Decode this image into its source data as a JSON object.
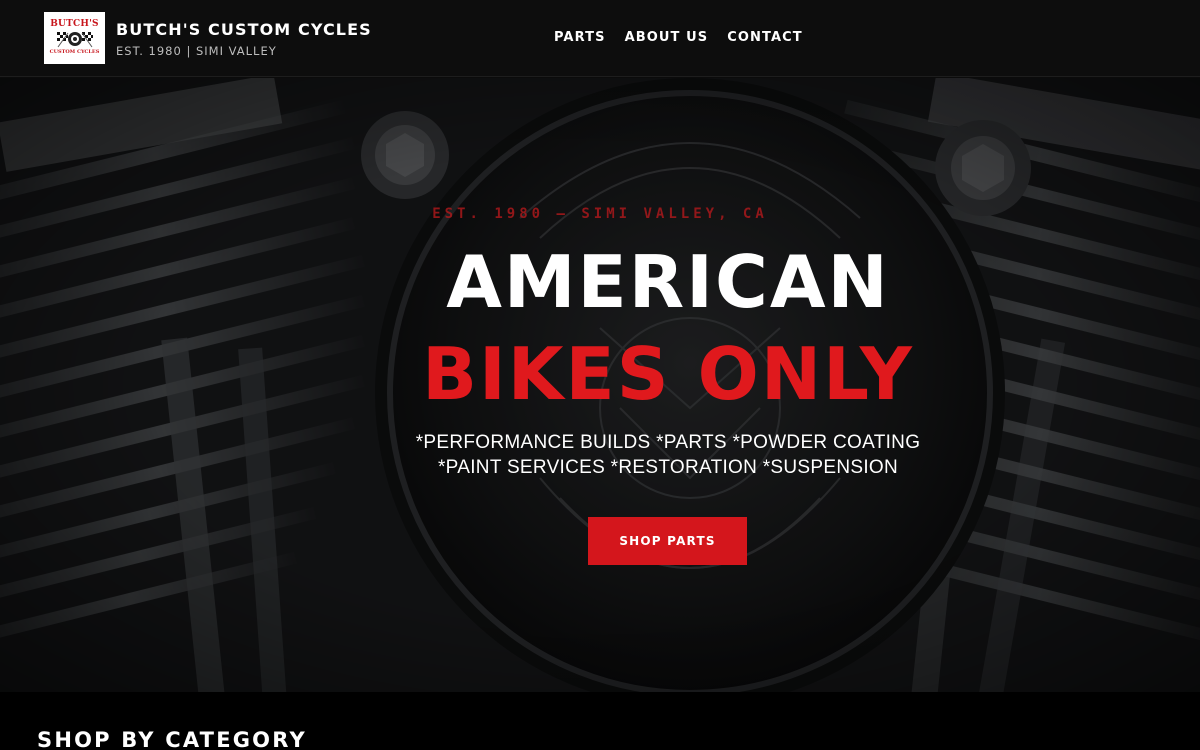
{
  "header": {
    "logo": {
      "seal_top": "BUTCH'S",
      "seal_bottom": "CUSTOM CYCLES"
    },
    "brand_name": "BUTCH'S CUSTOM CYCLES",
    "brand_sub": "EST. 1980 | SIMI VALLEY",
    "nav": [
      {
        "label": "PARTS"
      },
      {
        "label": "ABOUT US"
      },
      {
        "label": "CONTACT"
      }
    ]
  },
  "hero": {
    "eyebrow": "EST. 1980 — SIMI VALLEY, CA",
    "title_line_1": "AMERICAN",
    "title_line_2": "BIKES ONLY",
    "tagline": "*PERFORMANCE BUILDS *PARTS *POWDER COATING *PAINT SERVICES *RESTORATION *SUSPENSION",
    "cta_label": "SHOP PARTS",
    "background_image": "motorcycle-engine-air-cleaner",
    "accent_color": "#d4161c"
  },
  "section": {
    "title": "SHOP BY CATEGORY"
  }
}
